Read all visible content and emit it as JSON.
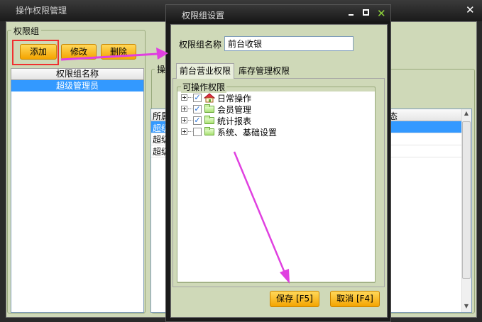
{
  "main_window": {
    "title": "操作权限管理",
    "close_glyph": "✕"
  },
  "perm_group": {
    "title": "权限组",
    "add_label": "添加",
    "edit_label": "修改",
    "delete_label": "删除",
    "list_header": "权限组名称",
    "rows": [
      "超级管理员"
    ]
  },
  "right_panel": {
    "label_partial": "操",
    "header_col1_partial": "所属",
    "header_col2_partial": "态",
    "rows_partial": [
      "超级",
      "超级",
      "超级"
    ]
  },
  "dialog": {
    "title": "权限组设置",
    "name_label": "权限组名称",
    "name_value": "前台收银",
    "tabs": [
      "前台营业权限",
      "库存管理权限"
    ],
    "tree_group_title": "可操作权限",
    "tree_items": [
      {
        "label": "日常操作",
        "checked": true,
        "icon": "home-icon"
      },
      {
        "label": "会员管理",
        "checked": true,
        "icon": "folder-icon"
      },
      {
        "label": "统计报表",
        "checked": true,
        "icon": "folder-icon"
      },
      {
        "label": "系统、基础设置",
        "checked": false,
        "icon": "folder-icon"
      }
    ],
    "save_label": "保存 [F5]",
    "cancel_label": "取消 [F4]"
  },
  "colors": {
    "accent_arrow": "#e040e0",
    "highlight_box": "#f03030",
    "selection": "#3399ff",
    "panel_bg": "#cfd9b8"
  }
}
